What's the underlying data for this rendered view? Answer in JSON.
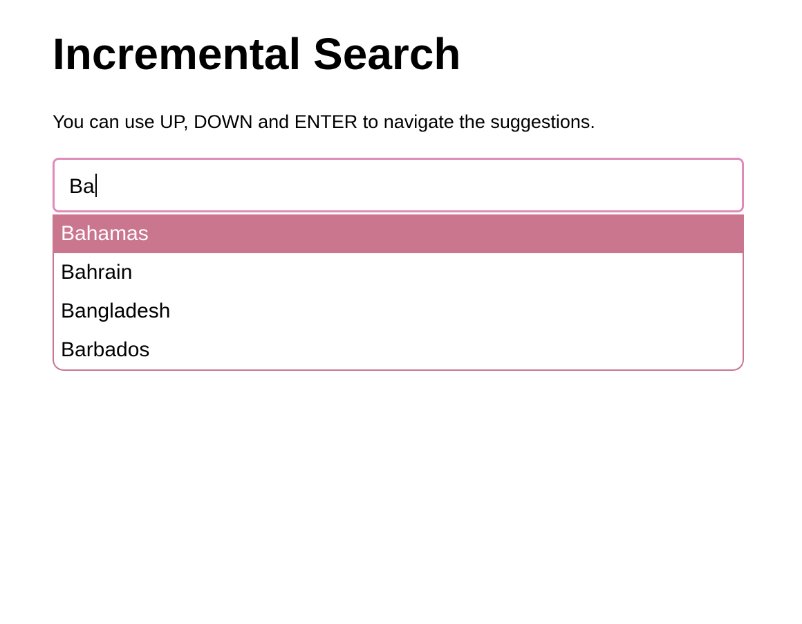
{
  "page": {
    "title": "Incremental Search",
    "instructions": "You can use UP, DOWN and ENTER to navigate the suggestions."
  },
  "search": {
    "value": "Ba",
    "suggestions": [
      {
        "label": "Bahamas",
        "active": true
      },
      {
        "label": "Bahrain",
        "active": false
      },
      {
        "label": "Bangladesh",
        "active": false
      },
      {
        "label": "Barbados",
        "active": false
      }
    ]
  },
  "colors": {
    "input_border": "#e08ab9",
    "dropdown_border": "#c97690",
    "active_bg": "#cb768f",
    "active_text": "#ffffff"
  }
}
